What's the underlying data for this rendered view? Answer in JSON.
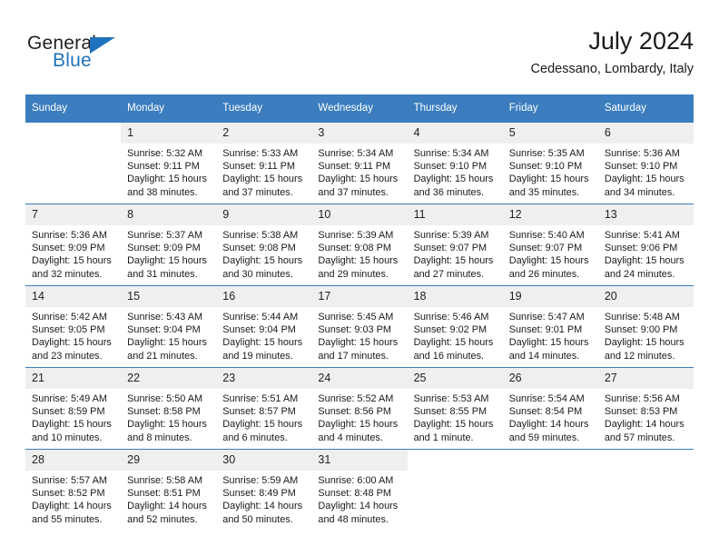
{
  "brand": {
    "name_top": "General",
    "name_bottom": "Blue",
    "accent_color": "#1f72bd",
    "triangle_icon": "triangle-icon"
  },
  "header": {
    "title": "July 2024",
    "subtitle": "Cedessano, Lombardy, Italy"
  },
  "calendar": {
    "header_bg": "#3b7dbf",
    "daynum_bg": "#efefef",
    "weekdays": [
      "Sunday",
      "Monday",
      "Tuesday",
      "Wednesday",
      "Thursday",
      "Friday",
      "Saturday"
    ],
    "weeks": [
      [
        {
          "day": "",
          "sunrise": "",
          "sunset": "",
          "daylight": "",
          "empty": true
        },
        {
          "day": "1",
          "sunrise": "Sunrise: 5:32 AM",
          "sunset": "Sunset: 9:11 PM",
          "daylight": "Daylight: 15 hours and 38 minutes."
        },
        {
          "day": "2",
          "sunrise": "Sunrise: 5:33 AM",
          "sunset": "Sunset: 9:11 PM",
          "daylight": "Daylight: 15 hours and 37 minutes."
        },
        {
          "day": "3",
          "sunrise": "Sunrise: 5:34 AM",
          "sunset": "Sunset: 9:11 PM",
          "daylight": "Daylight: 15 hours and 37 minutes."
        },
        {
          "day": "4",
          "sunrise": "Sunrise: 5:34 AM",
          "sunset": "Sunset: 9:10 PM",
          "daylight": "Daylight: 15 hours and 36 minutes."
        },
        {
          "day": "5",
          "sunrise": "Sunrise: 5:35 AM",
          "sunset": "Sunset: 9:10 PM",
          "daylight": "Daylight: 15 hours and 35 minutes."
        },
        {
          "day": "6",
          "sunrise": "Sunrise: 5:36 AM",
          "sunset": "Sunset: 9:10 PM",
          "daylight": "Daylight: 15 hours and 34 minutes."
        }
      ],
      [
        {
          "day": "7",
          "sunrise": "Sunrise: 5:36 AM",
          "sunset": "Sunset: 9:09 PM",
          "daylight": "Daylight: 15 hours and 32 minutes."
        },
        {
          "day": "8",
          "sunrise": "Sunrise: 5:37 AM",
          "sunset": "Sunset: 9:09 PM",
          "daylight": "Daylight: 15 hours and 31 minutes."
        },
        {
          "day": "9",
          "sunrise": "Sunrise: 5:38 AM",
          "sunset": "Sunset: 9:08 PM",
          "daylight": "Daylight: 15 hours and 30 minutes."
        },
        {
          "day": "10",
          "sunrise": "Sunrise: 5:39 AM",
          "sunset": "Sunset: 9:08 PM",
          "daylight": "Daylight: 15 hours and 29 minutes."
        },
        {
          "day": "11",
          "sunrise": "Sunrise: 5:39 AM",
          "sunset": "Sunset: 9:07 PM",
          "daylight": "Daylight: 15 hours and 27 minutes."
        },
        {
          "day": "12",
          "sunrise": "Sunrise: 5:40 AM",
          "sunset": "Sunset: 9:07 PM",
          "daylight": "Daylight: 15 hours and 26 minutes."
        },
        {
          "day": "13",
          "sunrise": "Sunrise: 5:41 AM",
          "sunset": "Sunset: 9:06 PM",
          "daylight": "Daylight: 15 hours and 24 minutes."
        }
      ],
      [
        {
          "day": "14",
          "sunrise": "Sunrise: 5:42 AM",
          "sunset": "Sunset: 9:05 PM",
          "daylight": "Daylight: 15 hours and 23 minutes."
        },
        {
          "day": "15",
          "sunrise": "Sunrise: 5:43 AM",
          "sunset": "Sunset: 9:04 PM",
          "daylight": "Daylight: 15 hours and 21 minutes."
        },
        {
          "day": "16",
          "sunrise": "Sunrise: 5:44 AM",
          "sunset": "Sunset: 9:04 PM",
          "daylight": "Daylight: 15 hours and 19 minutes."
        },
        {
          "day": "17",
          "sunrise": "Sunrise: 5:45 AM",
          "sunset": "Sunset: 9:03 PM",
          "daylight": "Daylight: 15 hours and 17 minutes."
        },
        {
          "day": "18",
          "sunrise": "Sunrise: 5:46 AM",
          "sunset": "Sunset: 9:02 PM",
          "daylight": "Daylight: 15 hours and 16 minutes."
        },
        {
          "day": "19",
          "sunrise": "Sunrise: 5:47 AM",
          "sunset": "Sunset: 9:01 PM",
          "daylight": "Daylight: 15 hours and 14 minutes."
        },
        {
          "day": "20",
          "sunrise": "Sunrise: 5:48 AM",
          "sunset": "Sunset: 9:00 PM",
          "daylight": "Daylight: 15 hours and 12 minutes."
        }
      ],
      [
        {
          "day": "21",
          "sunrise": "Sunrise: 5:49 AM",
          "sunset": "Sunset: 8:59 PM",
          "daylight": "Daylight: 15 hours and 10 minutes."
        },
        {
          "day": "22",
          "sunrise": "Sunrise: 5:50 AM",
          "sunset": "Sunset: 8:58 PM",
          "daylight": "Daylight: 15 hours and 8 minutes."
        },
        {
          "day": "23",
          "sunrise": "Sunrise: 5:51 AM",
          "sunset": "Sunset: 8:57 PM",
          "daylight": "Daylight: 15 hours and 6 minutes."
        },
        {
          "day": "24",
          "sunrise": "Sunrise: 5:52 AM",
          "sunset": "Sunset: 8:56 PM",
          "daylight": "Daylight: 15 hours and 4 minutes."
        },
        {
          "day": "25",
          "sunrise": "Sunrise: 5:53 AM",
          "sunset": "Sunset: 8:55 PM",
          "daylight": "Daylight: 15 hours and 1 minute."
        },
        {
          "day": "26",
          "sunrise": "Sunrise: 5:54 AM",
          "sunset": "Sunset: 8:54 PM",
          "daylight": "Daylight: 14 hours and 59 minutes."
        },
        {
          "day": "27",
          "sunrise": "Sunrise: 5:56 AM",
          "sunset": "Sunset: 8:53 PM",
          "daylight": "Daylight: 14 hours and 57 minutes."
        }
      ],
      [
        {
          "day": "28",
          "sunrise": "Sunrise: 5:57 AM",
          "sunset": "Sunset: 8:52 PM",
          "daylight": "Daylight: 14 hours and 55 minutes."
        },
        {
          "day": "29",
          "sunrise": "Sunrise: 5:58 AM",
          "sunset": "Sunset: 8:51 PM",
          "daylight": "Daylight: 14 hours and 52 minutes."
        },
        {
          "day": "30",
          "sunrise": "Sunrise: 5:59 AM",
          "sunset": "Sunset: 8:49 PM",
          "daylight": "Daylight: 14 hours and 50 minutes."
        },
        {
          "day": "31",
          "sunrise": "Sunrise: 6:00 AM",
          "sunset": "Sunset: 8:48 PM",
          "daylight": "Daylight: 14 hours and 48 minutes."
        },
        {
          "day": "",
          "sunrise": "",
          "sunset": "",
          "daylight": "",
          "empty": true
        },
        {
          "day": "",
          "sunrise": "",
          "sunset": "",
          "daylight": "",
          "empty": true
        },
        {
          "day": "",
          "sunrise": "",
          "sunset": "",
          "daylight": "",
          "empty": true
        }
      ]
    ]
  }
}
